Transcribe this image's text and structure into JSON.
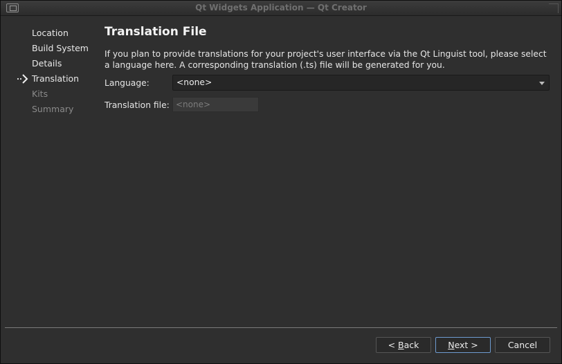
{
  "window": {
    "title": "Qt Widgets Application — Qt Creator"
  },
  "sidebar": {
    "items": [
      {
        "label": "Location",
        "state": "done"
      },
      {
        "label": "Build System",
        "state": "done"
      },
      {
        "label": "Details",
        "state": "done"
      },
      {
        "label": "Translation",
        "state": "current"
      },
      {
        "label": "Kits",
        "state": "pending"
      },
      {
        "label": "Summary",
        "state": "pending"
      }
    ],
    "current_marker_icon": "arrow-right-icon"
  },
  "page": {
    "title": "Translation File",
    "description": "If you plan to provide translations for your project's user interface via the Qt Linguist tool, please select a language here. A corresponding translation (.ts) file will be generated for you.",
    "language_label": "Language:",
    "language_value": "<none>",
    "translation_file_label": "Translation file:",
    "translation_file_value": "<none>"
  },
  "buttons": {
    "back": {
      "prefix": "< ",
      "mnemonic": "B",
      "rest": "ack"
    },
    "next": {
      "mnemonic": "N",
      "rest": "ext >"
    },
    "cancel": "Cancel"
  },
  "colors": {
    "background": "#2f2f2f",
    "default_button_border": "#6e9bd0",
    "dim_text": "#8a8a8a"
  }
}
